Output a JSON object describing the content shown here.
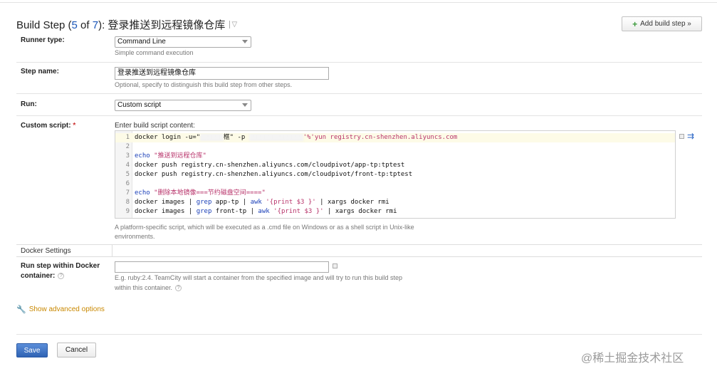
{
  "header": {
    "title_prefix": "Build Step (",
    "step_current": "5",
    "step_of": " of ",
    "step_total": "7",
    "title_suffix": "): 登录推送到远程镜像仓库",
    "add_step_label": "Add build step »"
  },
  "runner": {
    "label": "Runner type:",
    "value": "Command Line",
    "hint": "Simple command execution"
  },
  "step_name": {
    "label": "Step name:",
    "value": "登录推送到远程镜像仓库",
    "hint": "Optional, specify to distinguish this build step from other steps."
  },
  "run": {
    "label": "Run:",
    "value": "Custom script"
  },
  "custom_script": {
    "label": "Custom script:",
    "required_mark": "*",
    "content_label": "Enter build script content:",
    "lines": [
      {
        "n": "1",
        "kw": "",
        "text": "docker login -u=\"",
        "blur1": "xxxxxx",
        "mid": "框\" -p ",
        "blur2": "xxxxxxxxxxxxxx",
        "tail": "'%'yun registry.cn-shenzhen.aliyuncs.com"
      },
      {
        "n": "2"
      },
      {
        "n": "3",
        "kw": "echo ",
        "str": "\"推送到远程仓库\""
      },
      {
        "n": "4",
        "text": "docker push registry.cn-shenzhen.aliyuncs.com/cloudpivot/app-tp:tptest"
      },
      {
        "n": "5",
        "text": "docker push registry.cn-shenzhen.aliyuncs.com/cloudpivot/front-tp:tptest"
      },
      {
        "n": "6"
      },
      {
        "n": "7",
        "kw": "echo ",
        "str": "\"删除本地镜像===节约磁盘空间====\""
      },
      {
        "n": "8",
        "a": "docker images | ",
        "k1": "grep",
        "b": " app-tp | ",
        "k2": "awk",
        "c": " ",
        "s": "'{print $3 }'",
        "d": " | xargs docker rmi"
      },
      {
        "n": "9",
        "a": "docker images | ",
        "k1": "grep",
        "b": " front-tp | ",
        "k2": "awk",
        "c": " ",
        "s": "'{print $3 }'",
        "d": " | xargs docker rmi"
      }
    ],
    "hint_line1": "A platform-specific script, which will be executed as a .cmd file on Windows or as a shell script in Unix-like",
    "hint_line2": "environments."
  },
  "docker": {
    "section_title": "Docker Settings",
    "label_line1": "Run step within Docker",
    "label_line2": "container:",
    "value": "",
    "hint_line1": "E.g. ruby:2.4. TeamCity will start a container from the specified image and will try to run this build step",
    "hint_line2": "within this container.",
    "help_glyph": "?"
  },
  "advanced_label": "Show advanced options",
  "actions": {
    "save": "Save",
    "cancel": "Cancel"
  },
  "watermark": "@稀土掘金技术社区"
}
